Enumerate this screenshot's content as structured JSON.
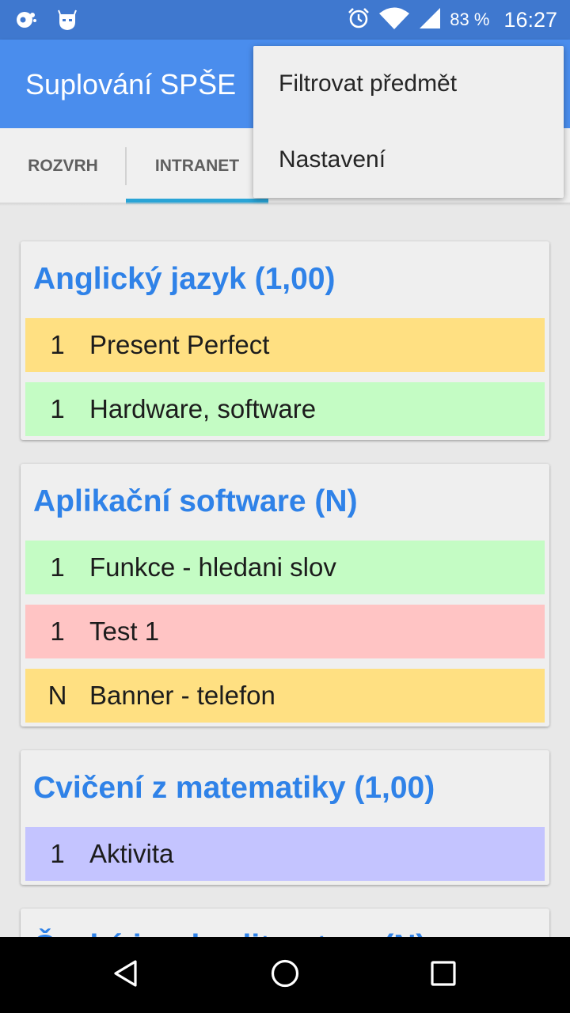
{
  "status_bar": {
    "battery_percent": "83 %",
    "time": "16:27",
    "icons": [
      "notification-icon",
      "android-icon",
      "alarm-icon",
      "wifi-icon",
      "signal-icon"
    ]
  },
  "app_bar": {
    "title": "Suplování SPŠE"
  },
  "tabs": [
    {
      "label": "ROZVRH",
      "selected": false
    },
    {
      "label": "INTRANET",
      "selected": true
    }
  ],
  "overflow_menu": {
    "items": [
      {
        "label": "Filtrovat předmět"
      },
      {
        "label": "Nastavení"
      }
    ]
  },
  "subjects": [
    {
      "title": "Anglický jazyk (1,00)",
      "items": [
        {
          "mark": "1",
          "label": "Present Perfect",
          "color": "#ffe082"
        },
        {
          "mark": "1",
          "label": "Hardware, software",
          "color": "#c4fcc4"
        }
      ]
    },
    {
      "title": "Aplikační software (N)",
      "items": [
        {
          "mark": "1",
          "label": "Funkce - hledani slov",
          "color": "#c4fcc4"
        },
        {
          "mark": "1",
          "label": "Test 1",
          "color": "#ffc4c4"
        },
        {
          "mark": "N",
          "label": "Banner - telefon",
          "color": "#ffe082"
        }
      ]
    },
    {
      "title": "Cvičení z matematiky (1,00)",
      "items": [
        {
          "mark": "1",
          "label": "Aktivita",
          "color": "#c4c4ff"
        }
      ]
    },
    {
      "title": "Český jazyk a literatura (N)",
      "items": []
    }
  ],
  "colors": {
    "status_bar": "#3f78cf",
    "app_bar": "#4a8ded",
    "accent_title": "#2f82e8",
    "tab_indicator": "#29a4d6"
  }
}
